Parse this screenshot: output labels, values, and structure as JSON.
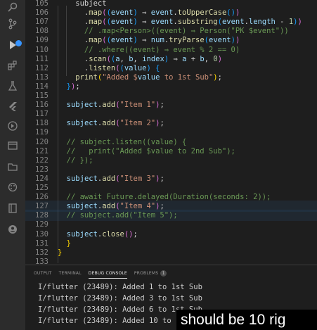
{
  "activity_bar": {
    "icons": [
      "search-icon",
      "source-control-icon",
      "run-debug-icon",
      "extensions-icon",
      "test-flask-icon",
      "flutter-icon",
      "timeline-icon",
      "remote-icon",
      "folder-icon",
      "paint-icon",
      "book-icon",
      "account-icon"
    ]
  },
  "editor": {
    "lines": [
      {
        "n": "105",
        "segs": [
          [
            "plain",
            "    subject"
          ]
        ]
      },
      {
        "n": "106",
        "segs": [
          [
            "plain",
            "      ."
          ],
          [
            "kw",
            "map"
          ],
          [
            "br2",
            "("
          ],
          [
            "br3",
            "("
          ],
          [
            "var",
            "event"
          ],
          [
            "br3",
            ")"
          ],
          [
            "plain",
            " ⇒ "
          ],
          [
            "var",
            "event"
          ],
          [
            "plain",
            "."
          ],
          [
            "kw",
            "toUpperCase"
          ],
          [
            "br3",
            "()"
          ],
          [
            "br2",
            ")"
          ]
        ]
      },
      {
        "n": "107",
        "segs": [
          [
            "plain",
            "      ."
          ],
          [
            "kw",
            "map"
          ],
          [
            "br2",
            "("
          ],
          [
            "br3",
            "("
          ],
          [
            "var",
            "event"
          ],
          [
            "br3",
            ")"
          ],
          [
            "plain",
            " ⇒ "
          ],
          [
            "var",
            "event"
          ],
          [
            "plain",
            "."
          ],
          [
            "kw",
            "substring"
          ],
          [
            "br3",
            "("
          ],
          [
            "var",
            "event"
          ],
          [
            "plain",
            "."
          ],
          [
            "var",
            "length"
          ],
          [
            "plain",
            " - "
          ],
          [
            "num",
            "1"
          ],
          [
            "br3",
            ")"
          ],
          [
            "br2",
            ")"
          ]
        ]
      },
      {
        "n": "108",
        "segs": [
          [
            "cm",
            "      // .map<Person>((event) ⇒ Person(\"PK $event\"))"
          ]
        ]
      },
      {
        "n": "109",
        "segs": [
          [
            "plain",
            "      ."
          ],
          [
            "kw",
            "map"
          ],
          [
            "br2",
            "("
          ],
          [
            "br3",
            "("
          ],
          [
            "var",
            "event"
          ],
          [
            "br3",
            ")"
          ],
          [
            "plain",
            " ⇒ "
          ],
          [
            "var",
            "num"
          ],
          [
            "plain",
            "."
          ],
          [
            "kw",
            "tryParse"
          ],
          [
            "br3",
            "("
          ],
          [
            "var",
            "event"
          ],
          [
            "br3",
            ")"
          ],
          [
            "br2",
            ")"
          ]
        ]
      },
      {
        "n": "110",
        "segs": [
          [
            "cm",
            "      // .where((event) ⇒ event % 2 == 0)"
          ]
        ]
      },
      {
        "n": "111",
        "segs": [
          [
            "plain",
            "      ."
          ],
          [
            "kw",
            "scan"
          ],
          [
            "br2",
            "("
          ],
          [
            "br3",
            "("
          ],
          [
            "var",
            "a"
          ],
          [
            "plain",
            ", "
          ],
          [
            "var",
            "b"
          ],
          [
            "plain",
            ", "
          ],
          [
            "var",
            "index"
          ],
          [
            "br3",
            ")"
          ],
          [
            "plain",
            " ⇒ "
          ],
          [
            "var",
            "a"
          ],
          [
            "plain",
            " + "
          ],
          [
            "var",
            "b"
          ],
          [
            "plain",
            ", "
          ],
          [
            "num",
            "0"
          ],
          [
            "br2",
            ")"
          ]
        ]
      },
      {
        "n": "112",
        "segs": [
          [
            "plain",
            "      ."
          ],
          [
            "kw",
            "listen"
          ],
          [
            "br2",
            "("
          ],
          [
            "br3",
            "("
          ],
          [
            "var",
            "value"
          ],
          [
            "br3",
            ")"
          ],
          [
            "plain",
            " "
          ],
          [
            "br3",
            "{"
          ]
        ]
      },
      {
        "n": "113",
        "segs": [
          [
            "plain",
            "    "
          ],
          [
            "kw",
            "print"
          ],
          [
            "br1",
            "("
          ],
          [
            "str",
            "\"Added $"
          ],
          [
            "var",
            "value"
          ],
          [
            "str",
            " to 1st Sub\""
          ],
          [
            "br1",
            ")"
          ],
          [
            "plain",
            ";"
          ]
        ]
      },
      {
        "n": "114",
        "segs": [
          [
            "plain",
            "  "
          ],
          [
            "br3",
            "}"
          ],
          [
            "br2",
            ")"
          ],
          [
            "plain",
            ";"
          ]
        ]
      },
      {
        "n": "115",
        "segs": [
          [
            "plain",
            ""
          ]
        ]
      },
      {
        "n": "116",
        "segs": [
          [
            "plain",
            "  "
          ],
          [
            "var",
            "subject"
          ],
          [
            "plain",
            "."
          ],
          [
            "kw",
            "add"
          ],
          [
            "br2",
            "("
          ],
          [
            "str",
            "\"Item 1\""
          ],
          [
            "br2",
            ")"
          ],
          [
            "plain",
            ";"
          ]
        ]
      },
      {
        "n": "117",
        "segs": [
          [
            "plain",
            ""
          ]
        ]
      },
      {
        "n": "118",
        "segs": [
          [
            "plain",
            "  "
          ],
          [
            "var",
            "subject"
          ],
          [
            "plain",
            "."
          ],
          [
            "kw",
            "add"
          ],
          [
            "br2",
            "("
          ],
          [
            "str",
            "\"Item 2\""
          ],
          [
            "br2",
            ")"
          ],
          [
            "plain",
            ";"
          ]
        ]
      },
      {
        "n": "119",
        "segs": [
          [
            "plain",
            ""
          ]
        ]
      },
      {
        "n": "120",
        "segs": [
          [
            "cm",
            "  // subject.listen((value) {"
          ]
        ]
      },
      {
        "n": "121",
        "segs": [
          [
            "cm",
            "  //   print(\"Added $value to 2nd Sub\");"
          ]
        ]
      },
      {
        "n": "122",
        "segs": [
          [
            "cm",
            "  // });"
          ]
        ]
      },
      {
        "n": "123",
        "segs": [
          [
            "plain",
            ""
          ]
        ]
      },
      {
        "n": "124",
        "segs": [
          [
            "plain",
            "  "
          ],
          [
            "var",
            "subject"
          ],
          [
            "plain",
            "."
          ],
          [
            "kw",
            "add"
          ],
          [
            "br2",
            "("
          ],
          [
            "str",
            "\"Item 3\""
          ],
          [
            "br2",
            ")"
          ],
          [
            "plain",
            ";"
          ]
        ]
      },
      {
        "n": "125",
        "segs": [
          [
            "plain",
            ""
          ]
        ]
      },
      {
        "n": "126",
        "segs": [
          [
            "cm",
            "  // await Future.delayed(Duration(seconds: 2));"
          ]
        ]
      },
      {
        "n": "127",
        "segs": [
          [
            "plain",
            "  "
          ],
          [
            "var",
            "subject"
          ],
          [
            "plain",
            "."
          ],
          [
            "kw",
            "add"
          ],
          [
            "br2",
            "("
          ],
          [
            "str",
            "\"Item 4\""
          ],
          [
            "br2",
            ")"
          ],
          [
            "plain",
            ";"
          ]
        ]
      },
      {
        "n": "128",
        "segs": [
          [
            "cm",
            "  // subject.add(\"Item 5\");"
          ]
        ]
      },
      {
        "n": "129",
        "segs": [
          [
            "plain",
            ""
          ]
        ]
      },
      {
        "n": "130",
        "segs": [
          [
            "plain",
            "  "
          ],
          [
            "var",
            "subject"
          ],
          [
            "plain",
            "."
          ],
          [
            "kw",
            "close"
          ],
          [
            "br2",
            "()"
          ],
          [
            "plain",
            ";"
          ]
        ]
      },
      {
        "n": "131",
        "segs": [
          [
            "plain",
            "  "
          ],
          [
            "br1",
            "}"
          ]
        ]
      },
      {
        "n": "132",
        "segs": [
          [
            "br1",
            "}"
          ]
        ]
      },
      {
        "n": "133",
        "segs": [
          [
            "plain",
            ""
          ]
        ]
      }
    ]
  },
  "panel": {
    "tabs": [
      {
        "label": "OUTPUT",
        "active": false
      },
      {
        "label": "TERMINAL",
        "active": false
      },
      {
        "label": "DEBUG CONSOLE",
        "active": true
      },
      {
        "label": "PROBLEMS",
        "active": false,
        "count": "1"
      }
    ],
    "output": [
      "I/flutter (23489): Added 1 to 1st Sub",
      "I/flutter (23489): Added 3 to 1st Sub",
      "I/flutter (23489): Added 6 to 1st Sub",
      "I/flutter (23489): Added 10 to 1st Sub"
    ]
  },
  "caption": "should be 10 rig",
  "colors": {
    "background": "#1e1e1e",
    "activity_bar": "#2c2c2c",
    "comment": "#6a9955",
    "string": "#ce9178",
    "method": "#dcdcaa",
    "variable": "#9cdcfe"
  }
}
